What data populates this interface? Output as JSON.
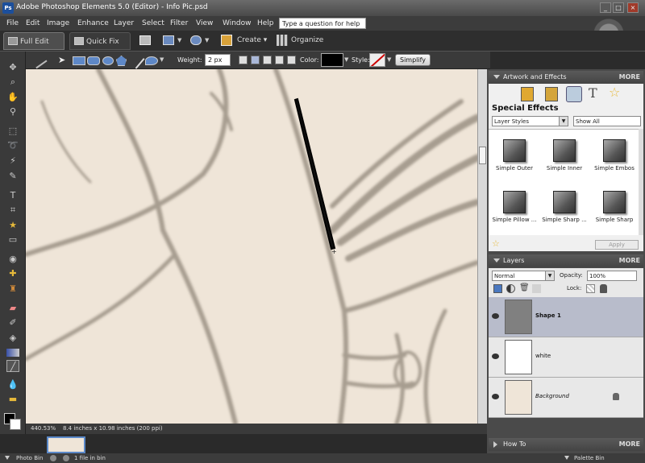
{
  "window": {
    "title": "Adobe Photoshop Elements 5.0 (Editor) - Info Pic.psd",
    "logo_text": "Ps",
    "controls": [
      "_",
      "□",
      "×"
    ]
  },
  "menubar": {
    "items": [
      "File",
      "Edit",
      "Image",
      "Enhance",
      "Layer",
      "Select",
      "Filter",
      "View",
      "Window",
      "Help"
    ],
    "help_box": "Type a question for help"
  },
  "modebar": {
    "full_edit": "Full Edit",
    "quick_fix": "Quick Fix",
    "create": "Create",
    "organize": "Organize"
  },
  "options": {
    "weight_label": "Weight:",
    "weight_value": "2 px",
    "color_label": "Color:",
    "color_value": "#000000",
    "style_label": "Style:",
    "simplify": "Simplify"
  },
  "status": {
    "zoom": "440.53%",
    "doc_size": "8.4 inches x 10.98 inches (200 ppi)"
  },
  "bottom": {
    "photo_bin": "Photo Bin",
    "files": "1 file in bin",
    "palette_bin": "Palette Bin"
  },
  "artwork": {
    "title": "Artwork and Effects",
    "more": "MORE",
    "section": "Special Effects",
    "dropdown1": "Layer Styles",
    "dropdown2": "Show All",
    "effects": [
      "Simple Outer",
      "Simple Inner",
      "Simple Embos",
      "Simple Pillow ...",
      "Simple Sharp ...",
      "Simple Sharp"
    ],
    "apply": "Apply"
  },
  "layers": {
    "title": "Layers",
    "more": "MORE",
    "blend_mode": "Normal",
    "opacity_label": "Opacity:",
    "opacity_value": "100%",
    "lock_label": "Lock:",
    "items": [
      {
        "name": "Shape 1",
        "selected": true
      },
      {
        "name": "white",
        "selected": false
      },
      {
        "name": "Background",
        "selected": false
      }
    ]
  },
  "howto": {
    "title": "How To",
    "more": "MORE"
  }
}
